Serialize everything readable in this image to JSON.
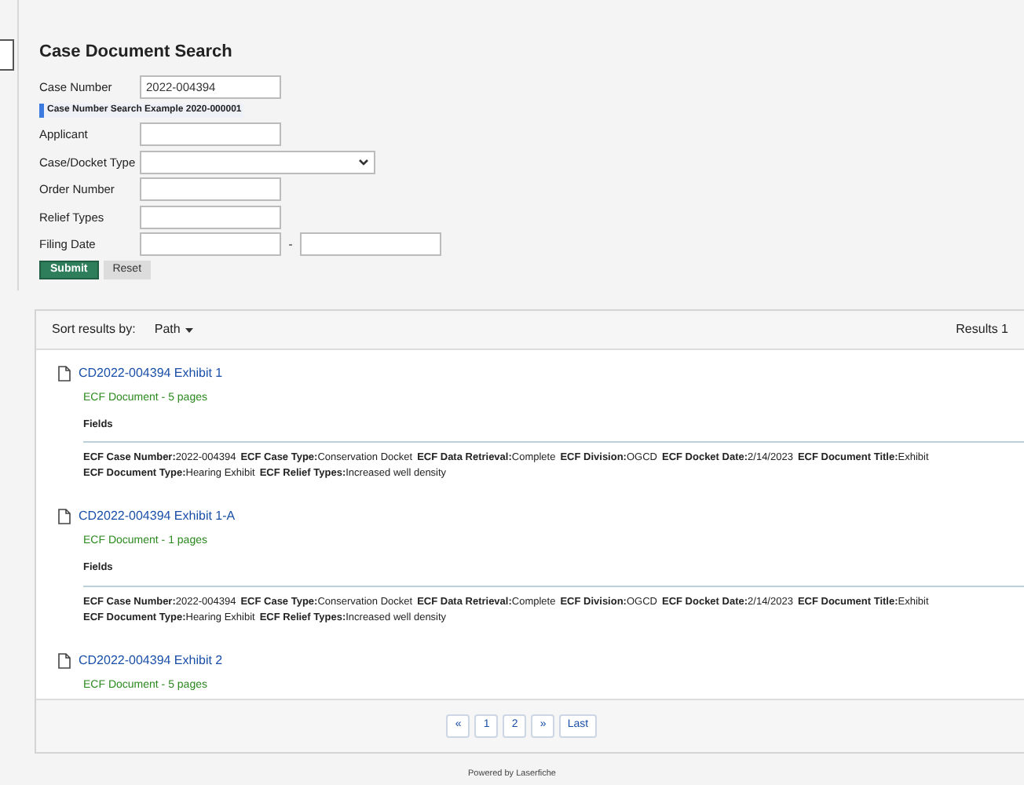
{
  "search_form": {
    "title": "Case Document Search",
    "fields": [
      {
        "label": "Case Number",
        "kind": "text",
        "value": "2022-004394"
      },
      {
        "kind": "hint",
        "text": "Case Number Search Example 2020-000001"
      },
      {
        "label": "Applicant",
        "kind": "text"
      },
      {
        "label": "Case/Docket Type",
        "kind": "select"
      },
      {
        "label": "Order Number",
        "kind": "text"
      },
      {
        "label": "Relief Types",
        "kind": "text"
      },
      {
        "label": "Filing Date",
        "kind": "range",
        "separator": "-"
      }
    ],
    "buttons": [
      {
        "label": "Submit",
        "kind": "primary"
      },
      {
        "label": "Reset",
        "kind": "secondary"
      }
    ]
  },
  "results": {
    "sort_label": "Sort results by:",
    "sort_value": "Path",
    "count": "Results 1",
    "items": [
      {
        "title": "CD2022-004394 Exhibit 1",
        "subtitle": "ECF Document - 5 pages",
        "fields_heading": "Fields",
        "field_lines": [
          [
            {
              "label": "ECF Case Number:",
              "value": "2022-004394"
            },
            {
              "label": "ECF Case Type:",
              "value": "Conservation Docket"
            },
            {
              "label": "ECF Data Retrieval:",
              "value": "Complete"
            },
            {
              "label": "ECF Division:",
              "value": "OGCD"
            },
            {
              "label": "ECF Docket Date:",
              "value": "2/14/2023"
            },
            {
              "label": "ECF Document Title:",
              "value": "Exhibit"
            }
          ],
          [
            {
              "label": "ECF Document Type:",
              "value": "Hearing Exhibit"
            },
            {
              "label": "ECF Relief Types:",
              "value": "Increased well density"
            }
          ]
        ]
      },
      {
        "title": "CD2022-004394 Exhibit 1-A",
        "subtitle": "ECF Document - 1 pages",
        "fields_heading": "Fields",
        "field_lines": [
          [
            {
              "label": "ECF Case Number:",
              "value": "2022-004394"
            },
            {
              "label": "ECF Case Type:",
              "value": "Conservation Docket"
            },
            {
              "label": "ECF Data Retrieval:",
              "value": "Complete"
            },
            {
              "label": "ECF Division:",
              "value": "OGCD"
            },
            {
              "label": "ECF Docket Date:",
              "value": "2/14/2023"
            },
            {
              "label": "ECF Document Title:",
              "value": "Exhibit"
            }
          ],
          [
            {
              "label": "ECF Document Type:",
              "value": "Hearing Exhibit"
            },
            {
              "label": "ECF Relief Types:",
              "value": "Increased well density"
            }
          ]
        ]
      },
      {
        "title": "CD2022-004394 Exhibit 2",
        "subtitle": "ECF Document - 5 pages"
      }
    ],
    "pagination": [
      "«",
      "1",
      "2",
      "»",
      "Last"
    ]
  },
  "footer": "Powered by Laserfiche"
}
